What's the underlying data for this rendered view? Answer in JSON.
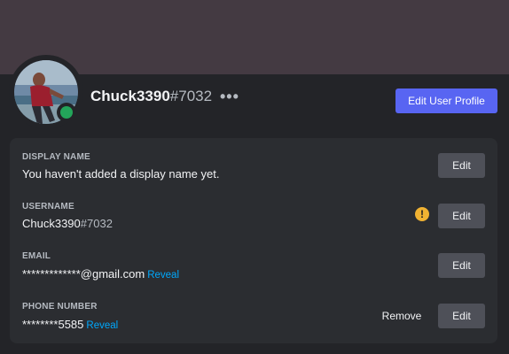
{
  "profile": {
    "username": "Chuck3390",
    "discriminator": "#7032",
    "status": "online",
    "edit_profile_label": "Edit User Profile"
  },
  "fields": {
    "display_name": {
      "label": "DISPLAY NAME",
      "value": "You haven't added a display name yet.",
      "edit_label": "Edit"
    },
    "username": {
      "label": "USERNAME",
      "value": "Chuck3390",
      "discriminator": "#7032",
      "warning_icon": "exclamation-icon",
      "edit_label": "Edit"
    },
    "email": {
      "label": "EMAIL",
      "value": "*************@gmail.com",
      "reveal_label": "Reveal",
      "edit_label": "Edit"
    },
    "phone": {
      "label": "PHONE NUMBER",
      "value": "********5585",
      "reveal_label": "Reveal",
      "remove_label": "Remove",
      "edit_label": "Edit"
    }
  },
  "colors": {
    "banner": "#443a42",
    "accent": "#5865f2",
    "online": "#23a55a",
    "warning": "#f0b232",
    "link": "#00a8fc"
  }
}
